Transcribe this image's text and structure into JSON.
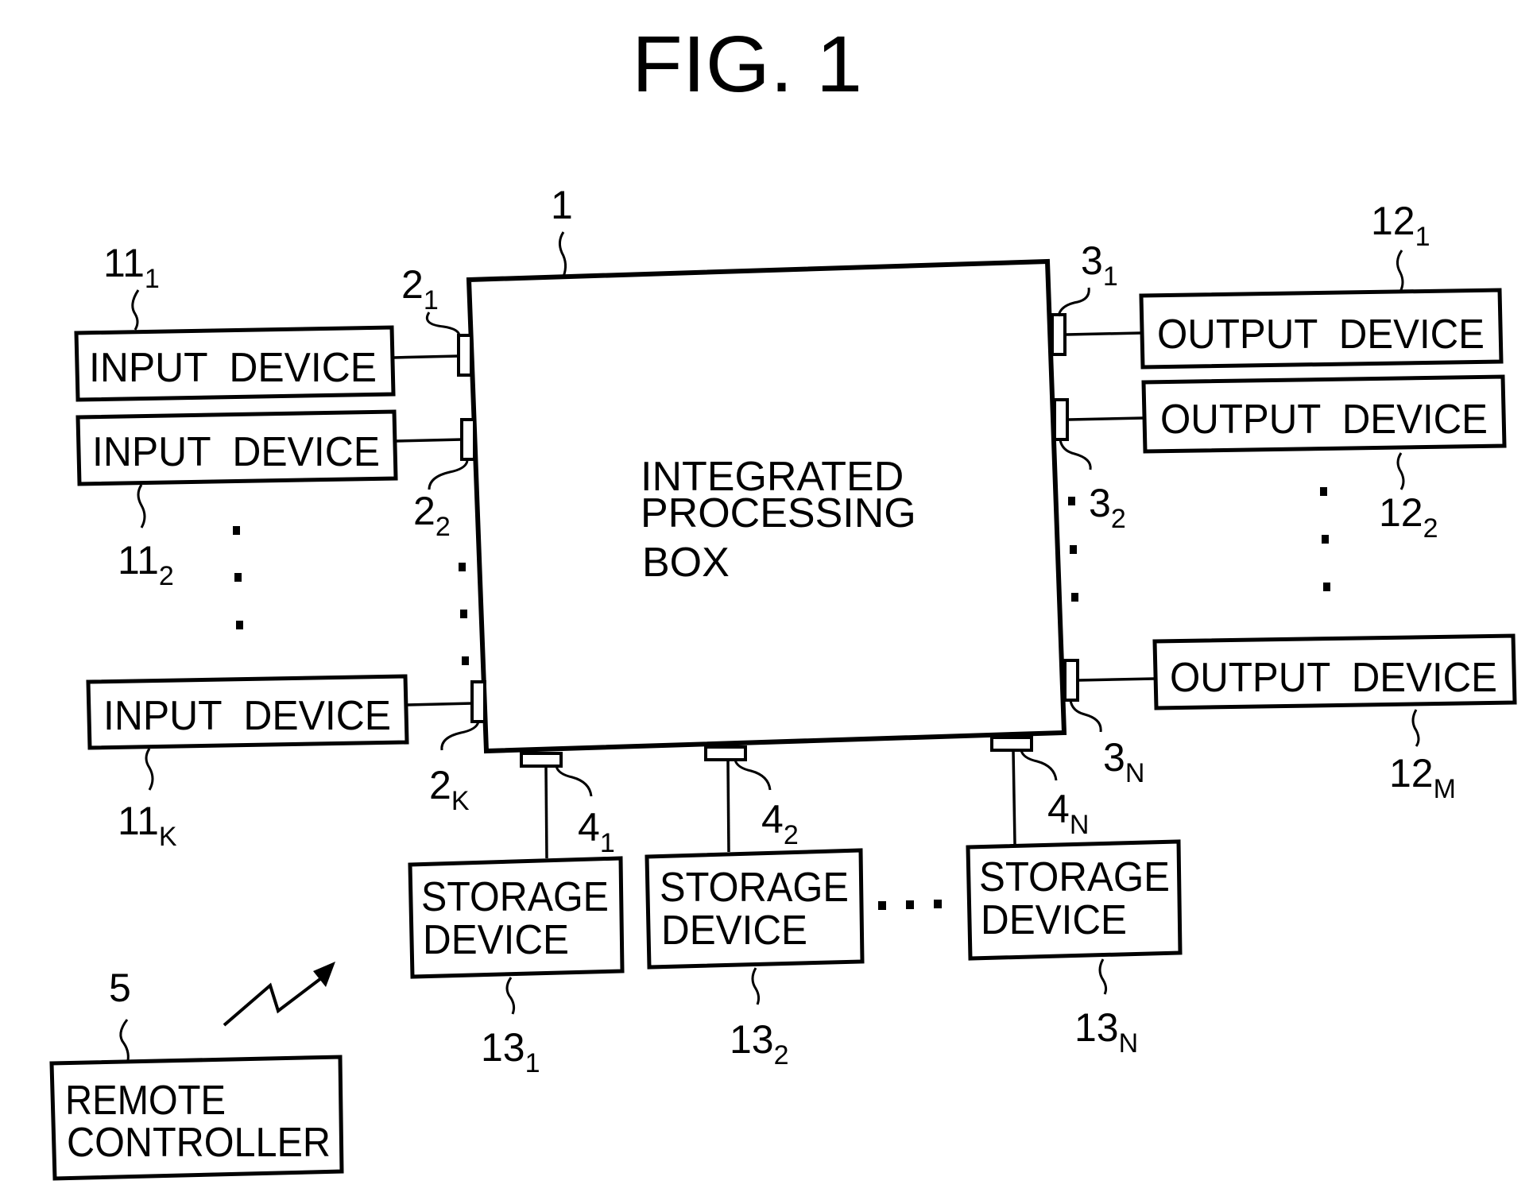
{
  "figure": {
    "title": "FIG. 1",
    "main_box": {
      "ref": "1",
      "lines": [
        "INTEGRATED",
        "PROCESSING",
        "BOX"
      ]
    },
    "input_devices": [
      {
        "label": "INPUT  DEVICE",
        "ref": "11",
        "ref_sub": "1",
        "port": "2",
        "port_sub": "1"
      },
      {
        "label": "INPUT  DEVICE",
        "ref": "11",
        "ref_sub": "2",
        "port": "2",
        "port_sub": "2"
      },
      {
        "label": "INPUT  DEVICE",
        "ref": "11",
        "ref_sub": "K",
        "port": "2",
        "port_sub": "K"
      }
    ],
    "output_devices": [
      {
        "label": "OUTPUT  DEVICE",
        "ref": "12",
        "ref_sub": "1",
        "port": "3",
        "port_sub": "1"
      },
      {
        "label": "OUTPUT  DEVICE",
        "ref": "12",
        "ref_sub": "2",
        "port": "3",
        "port_sub": "2"
      },
      {
        "label": "OUTPUT  DEVICE",
        "ref": "12",
        "ref_sub": "M",
        "port": "3",
        "port_sub": "N"
      }
    ],
    "storage_devices": [
      {
        "lines": [
          "STORAGE",
          "DEVICE"
        ],
        "ref": "13",
        "ref_sub": "1",
        "port": "4",
        "port_sub": "1"
      },
      {
        "lines": [
          "STORAGE",
          "DEVICE"
        ],
        "ref": "13",
        "ref_sub": "2",
        "port": "4",
        "port_sub": "2"
      },
      {
        "lines": [
          "STORAGE",
          "DEVICE"
        ],
        "ref": "13",
        "ref_sub": "N",
        "port": "4",
        "port_sub": "N"
      }
    ],
    "remote_controller": {
      "lines": [
        "REMOTE",
        "CONTROLLER"
      ],
      "ref": "5",
      "signal_icon": "wireless-signal-arrow"
    },
    "ellipsis": "..."
  }
}
